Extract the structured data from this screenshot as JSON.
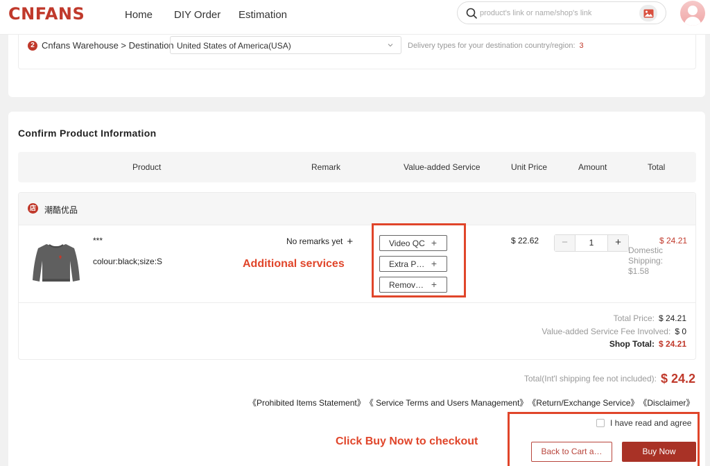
{
  "header": {
    "logo": "CNFANS",
    "nav": [
      "Home",
      "DIY Order",
      "Estimation"
    ],
    "search_placeholder": "product's link or name/shop's link"
  },
  "destination": {
    "step": "2",
    "label": "Cnfans Warehouse > Destination",
    "selected": "United States of America(USA)",
    "delivery_text": "Delivery types for your destination country/region:",
    "delivery_count": "3"
  },
  "confirm": {
    "title": "Confirm Product Information",
    "columns": [
      "Product",
      "Remark",
      "Value-added Service",
      "Unit Price",
      "Amount",
      "Total"
    ],
    "shop": {
      "icon_text": "店",
      "name": "潮酷优品"
    },
    "product": {
      "name": "***",
      "spec": "colour:black;size:S",
      "remark": "No remarks yet",
      "services": [
        "Video QC",
        "Extra P…",
        "Remov…"
      ],
      "unit_price": "$ 22.62",
      "quantity": "1",
      "total": "$ 24.21",
      "domestic_shipping": "Domestic Shipping: $1.58"
    },
    "summary": {
      "total_price_label": "Total Price:",
      "total_price": "$ 24.21",
      "fee_label": "Value-added Service Fee Involved:",
      "fee": "$ 0",
      "shop_total_label": "Shop Total:",
      "shop_total": "$ 24.21"
    },
    "grand_total_label": "Total(Int'l shipping fee not included):",
    "grand_total": "$ 24.2",
    "links": [
      "《Prohibited Items Statement》",
      "《 Service Terms and Users Management》",
      "《Return/Exchange Service》",
      "《Disclaimer》"
    ],
    "agree_label": "I have read and agree",
    "back_button": "Back to Cart a…",
    "buy_button": "Buy Now"
  },
  "annotations": {
    "services": "Additional services",
    "checkout": "Click Buy Now to checkout"
  },
  "colors": {
    "brand": "#c0392b",
    "buy_button": "#a93226",
    "annotation": "#e0452a"
  }
}
